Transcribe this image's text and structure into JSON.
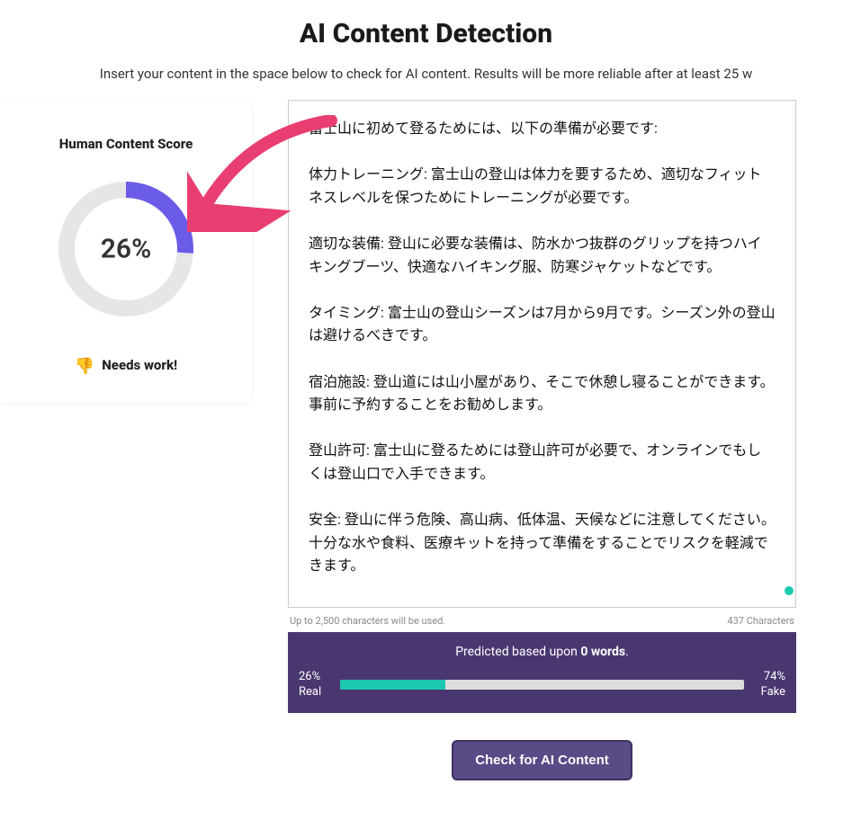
{
  "header": {
    "title": "AI Content Detection",
    "subtitle": "Insert your content in the space below to check for AI content. Results will be more reliable after at least 25 w"
  },
  "score_card": {
    "title": "Human Content Score",
    "percent": 26,
    "percent_display": "26%",
    "verdict_emoji": "👎",
    "verdict_text": "Needs work!",
    "donut_color": "#6b5ce7",
    "donut_track": "#e6e6e6"
  },
  "main": {
    "textarea_value": "富士山に初めて登るためには、以下の準備が必要です:\n\n体力トレーニング: 富士山の登山は体力を要するため、適切なフィットネスレベルを保つためにトレーニングが必要です。\n\n適切な装備: 登山に必要な装備は、防水かつ抜群のグリップを持つハイキングブーツ、快適なハイキング服、防寒ジャケットなどです。\n\nタイミング: 富士山の登山シーズンは7月から9月です。シーズン外の登山は避けるべきです。\n\n宿泊施設: 登山道には山小屋があり、そこで休憩し寝ることができます。事前に予約することをお勧めします。\n\n登山許可: 富士山に登るためには登山許可が必要で、オンラインでもしくは登山口で入手できます。\n\n安全: 登山に伴う危険、高山病、低体温、天候などに注意してください。十分な水や食料、医療キットを持って準備をすることでリスクを軽減できます。",
    "limit_note": "Up to 2,500 characters will be used.",
    "char_count_label": "437 Characters"
  },
  "prediction": {
    "prefix": "Predicted based upon ",
    "word_count": "0 words",
    "suffix": ".",
    "real_percent": "26%",
    "real_label": "Real",
    "fake_percent": "74%",
    "fake_label": "Fake",
    "bar_fill_percent": 26
  },
  "button": {
    "check_label": "Check for AI Content"
  },
  "chart_data": {
    "type": "bar",
    "title": "Human Content Score",
    "categories": [
      "Real",
      "Fake"
    ],
    "values": [
      26,
      74
    ],
    "xlabel": "",
    "ylabel": "%",
    "ylim": [
      0,
      100
    ],
    "colors": {
      "Real": "#1cc9b0",
      "Fake": "#dddddd"
    }
  }
}
